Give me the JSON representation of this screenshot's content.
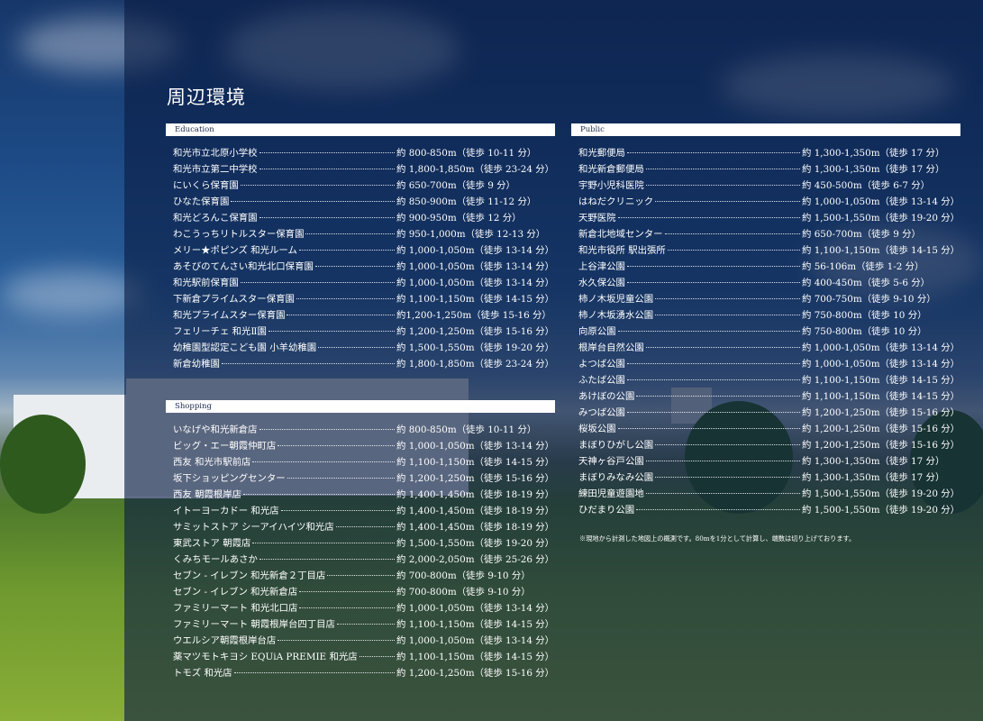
{
  "title": "周辺環境",
  "sections": {
    "education": {
      "label": "Education",
      "items": [
        {
          "name": "和光市立北原小学校",
          "distance": "約 800-850m（徒歩 10-11 分）"
        },
        {
          "name": "和光市立第二中学校",
          "distance": "約 1,800-1,850m（徒歩 23-24 分）"
        },
        {
          "name": "にいくら保育園",
          "distance": "約 650-700m（徒歩 9 分）"
        },
        {
          "name": "ひなた保育園",
          "distance": "約 850-900m（徒歩 11-12 分）"
        },
        {
          "name": "和光どろんこ保育園",
          "distance": "約 900-950m（徒歩 12 分）"
        },
        {
          "name": "わこうっちリトルスター保育園",
          "distance": "約 950-1,000m（徒歩 12-13 分）"
        },
        {
          "name": "メリー★ポピンズ 和光ルーム",
          "distance": "約 1,000-1,050m（徒歩 13-14 分）"
        },
        {
          "name": "あそびのてんさい和光北口保育園",
          "distance": "約 1,000-1,050m（徒歩 13-14 分）"
        },
        {
          "name": "和光駅前保育園",
          "distance": "約 1,000-1,050m（徒歩 13-14 分）"
        },
        {
          "name": "下新倉プライムスター保育園",
          "distance": "約 1,100-1,150m（徒歩 14-15 分）"
        },
        {
          "name": "和光プライムスター保育園",
          "distance": "約1,200-1,250m（徒歩 15-16 分）"
        },
        {
          "name": "フェリーチェ 和光Ⅱ園",
          "distance": "約 1,200-1,250m（徒歩 15-16 分）"
        },
        {
          "name": "幼稚園型認定こども園 小羊幼稚園",
          "distance": "約 1,500-1,550m（徒歩 19-20 分）"
        },
        {
          "name": "新倉幼稚園",
          "distance": "約 1,800-1,850m（徒歩 23-24 分）"
        }
      ]
    },
    "shopping": {
      "label": "Shopping",
      "items": [
        {
          "name": "いなげや和光新倉店",
          "distance": "約 800-850m（徒歩 10-11 分）"
        },
        {
          "name": "ビッグ・エー朝霞仲町店",
          "distance": "約 1,000-1,050m（徒歩 13-14 分）"
        },
        {
          "name": "西友 和光市駅前店",
          "distance": "約 1,100-1,150m（徒歩 14-15 分）"
        },
        {
          "name": "坂下ショッピングセンター",
          "distance": "約 1,200-1,250m（徒歩 15-16 分）"
        },
        {
          "name": "西友 朝霞根岸店",
          "distance": "約 1,400-1,450m（徒歩 18-19 分）"
        },
        {
          "name": "イトーヨーカドー 和光店",
          "distance": "約 1,400-1,450m（徒歩 18-19 分）"
        },
        {
          "name": "サミットストア シーアイハイツ和光店",
          "distance": "約 1,400-1,450m（徒歩 18-19 分）"
        },
        {
          "name": "東武ストア 朝霞店",
          "distance": "約 1,500-1,550m（徒歩 19-20 分）"
        },
        {
          "name": "くみちモールあさか",
          "distance": "約 2,000-2,050m（徒歩 25-26 分）"
        },
        {
          "name": "セブン - イレブン 和光新倉２丁目店",
          "distance": "約 700-800m（徒歩 9-10 分）"
        },
        {
          "name": "セブン - イレブン 和光新倉店",
          "distance": "約 700-800m（徒歩 9-10 分）"
        },
        {
          "name": "ファミリーマート 和光北口店",
          "distance": "約 1,000-1,050m（徒歩 13-14 分）"
        },
        {
          "name": "ファミリーマート 朝霞根岸台四丁目店",
          "distance": "約 1,100-1,150m（徒歩 14-15 分）"
        },
        {
          "name": "ウエルシア朝霞根岸台店",
          "distance": "約 1,000-1,050m（徒歩 13-14 分）"
        },
        {
          "name": "薬マツモトキヨシ EQUiA PREMIE 和光店",
          "distance": "約 1,100-1,150m（徒歩 14-15 分）"
        },
        {
          "name": "トモズ 和光店",
          "distance": "約 1,200-1,250m（徒歩 15-16 分）"
        }
      ]
    },
    "public": {
      "label": "Public",
      "items": [
        {
          "name": "和光郵便局",
          "distance": "約 1,300-1,350m（徒歩 17 分）"
        },
        {
          "name": "和光新倉郵便局",
          "distance": "約 1,300-1,350m（徒歩 17 分）"
        },
        {
          "name": "宇野小児科医院",
          "distance": "約 450-500m（徒歩 6-7 分）"
        },
        {
          "name": "はねだクリニック",
          "distance": "約 1,000-1,050m（徒歩 13-14 分）"
        },
        {
          "name": "天野医院",
          "distance": "約 1,500-1,550m（徒歩 19-20 分）"
        },
        {
          "name": "新倉北地域センター",
          "distance": "約 650-700m（徒歩 9 分）"
        },
        {
          "name": "和光市役所 駅出張所",
          "distance": "約 1,100-1,150m（徒歩 14-15 分）"
        },
        {
          "name": "上谷津公園",
          "distance": "約 56-106m（徒歩 1-2 分）"
        },
        {
          "name": "水久保公園",
          "distance": "約 400-450m（徒歩 5-6 分）"
        },
        {
          "name": "柿ノ木坂児童公園",
          "distance": "約 700-750m（徒歩 9-10 分）"
        },
        {
          "name": "柿ノ木坂湧水公園",
          "distance": "約 750-800m（徒歩 10 分）"
        },
        {
          "name": "向原公園",
          "distance": "約 750-800m（徒歩 10 分）"
        },
        {
          "name": "根岸台自然公園",
          "distance": "約 1,000-1,050m（徒歩 13-14 分）"
        },
        {
          "name": "よつば公園",
          "distance": "約 1,000-1,050m（徒歩 13-14 分）"
        },
        {
          "name": "ふたば公園",
          "distance": "約 1,100-1,150m（徒歩 14-15 分）"
        },
        {
          "name": "あけぼの公園",
          "distance": "約 1,100-1,150m（徒歩 14-15 分）"
        },
        {
          "name": "みつば公園",
          "distance": "約 1,200-1,250m（徒歩 15-16 分）"
        },
        {
          "name": "桜坂公園",
          "distance": "約 1,200-1,250m（徒歩 15-16 分）"
        },
        {
          "name": "まぼりひがし公園",
          "distance": "約 1,200-1,250m（徒歩 15-16 分）"
        },
        {
          "name": "天神ヶ谷戸公園",
          "distance": "約 1,300-1,350m（徒歩 17 分）"
        },
        {
          "name": "まぼりみなみ公園",
          "distance": "約 1,300-1,350m（徒歩 17 分）"
        },
        {
          "name": "練田児童遊園地",
          "distance": "約 1,500-1,550m（徒歩 19-20 分）"
        },
        {
          "name": "ひだまり公園",
          "distance": "約 1,500-1,550m（徒歩 19-20 分）"
        }
      ]
    }
  },
  "note": "※現地から計測した地図上の概測です。80mを1分として計算し、端数は切り上げております。"
}
